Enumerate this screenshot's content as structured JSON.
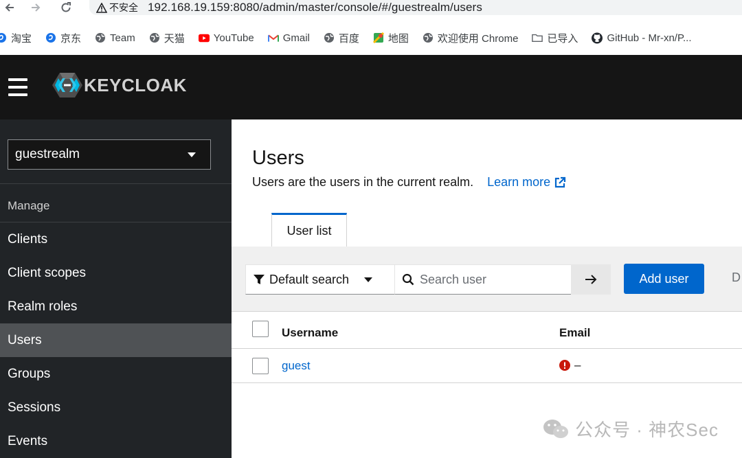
{
  "browser": {
    "security_label": "不安全",
    "url": "192.168.19.159:8080/admin/master/console/#/guestrealm/users",
    "bookmarks": [
      {
        "label": "淘宝",
        "icon": "swirl-icon"
      },
      {
        "label": "京东",
        "icon": "swirl-icon"
      },
      {
        "label": "Team",
        "icon": "globe-icon"
      },
      {
        "label": "天猫",
        "icon": "globe-icon"
      },
      {
        "label": "YouTube",
        "icon": "youtube-icon"
      },
      {
        "label": "Gmail",
        "icon": "gmail-icon"
      },
      {
        "label": "百度",
        "icon": "globe-icon"
      },
      {
        "label": "地图",
        "icon": "maps-icon"
      },
      {
        "label": "欢迎使用 Chrome",
        "icon": "globe-icon"
      },
      {
        "label": "已导入",
        "icon": "folder-icon"
      },
      {
        "label": "GitHub - Mr-xn/P...",
        "icon": "github-icon"
      }
    ]
  },
  "header": {
    "logo_text": "KEYCLOAK"
  },
  "sidebar": {
    "realm": "guestrealm",
    "section": "Manage",
    "items": [
      {
        "label": "Clients",
        "active": false
      },
      {
        "label": "Client scopes",
        "active": false
      },
      {
        "label": "Realm roles",
        "active": false
      },
      {
        "label": "Users",
        "active": true
      },
      {
        "label": "Groups",
        "active": false
      },
      {
        "label": "Sessions",
        "active": false
      },
      {
        "label": "Events",
        "active": false
      }
    ]
  },
  "main": {
    "title": "Users",
    "description": "Users are the users in the current realm.",
    "learn_more": "Learn more",
    "tabs": [
      {
        "label": "User list",
        "active": true
      }
    ],
    "toolbar": {
      "filter_label": "Default search",
      "search_placeholder": "Search user",
      "add_user": "Add user",
      "cut_off_button": "D"
    },
    "table": {
      "columns": [
        "Username",
        "Email"
      ],
      "rows": [
        {
          "username": "guest",
          "email": "–",
          "email_status": "unverified-error"
        }
      ]
    }
  },
  "watermark": "公众号 · 神农Sec",
  "colors": {
    "brand_blue": "#0066cc",
    "header_bg": "#151515",
    "sidebar_bg": "#212427",
    "active_nav": "#4f5255",
    "error_red": "#c9190b"
  }
}
